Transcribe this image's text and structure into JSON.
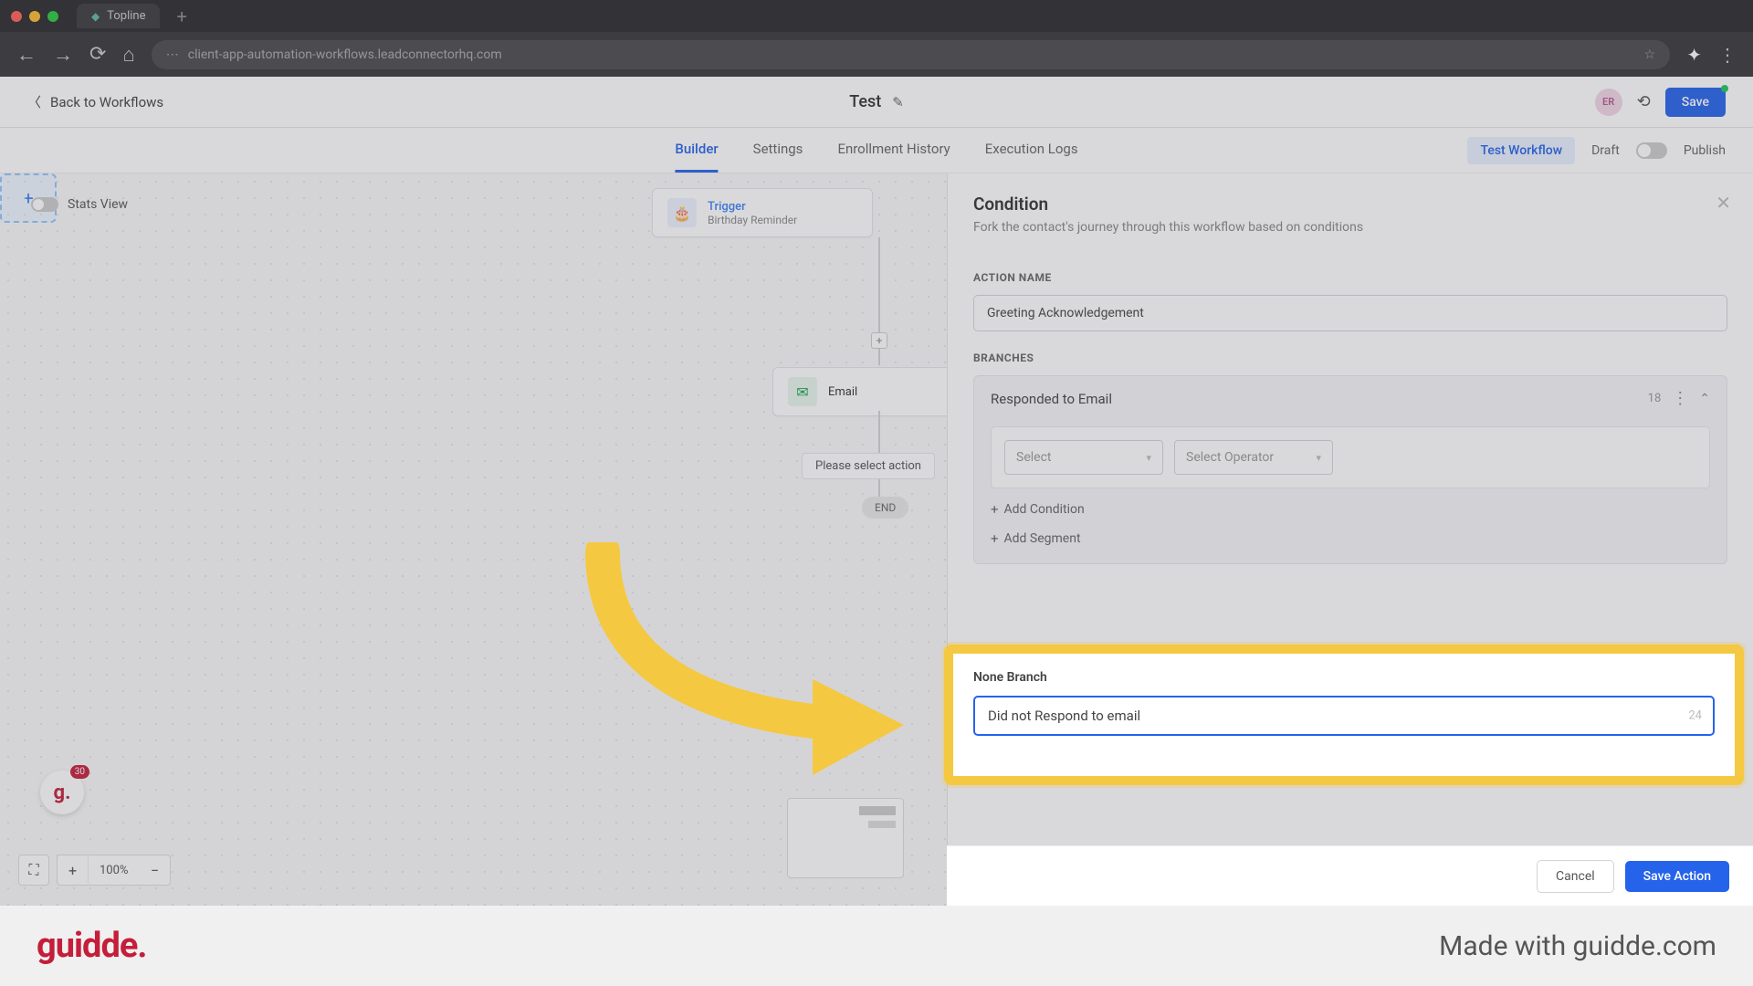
{
  "browser": {
    "tab_title": "Topline",
    "url": "client-app-automation-workflows.leadconnectorhq.com"
  },
  "header": {
    "back_label": "Back to Workflows",
    "workflow_title": "Test",
    "avatar_initials": "ER",
    "save_label": "Save"
  },
  "tabs": {
    "builder": "Builder",
    "settings": "Settings",
    "enrollment": "Enrollment History",
    "execution": "Execution Logs",
    "test_workflow": "Test Workflow",
    "draft": "Draft",
    "publish": "Publish"
  },
  "canvas": {
    "stats_view": "Stats View",
    "trigger_title": "Trigger",
    "trigger_sub": "Birthday Reminder",
    "email_label": "Email",
    "select_action": "Please select action",
    "end_label": "END",
    "zoom_pct": "100%"
  },
  "panel": {
    "title": "Condition",
    "desc": "Fork the contact's journey through this workflow based on conditions",
    "action_name_label": "ACTION NAME",
    "action_name_value": "Greeting Acknowledgement",
    "branches_label": "BRANCHES",
    "branch1_name": "Responded to Email",
    "branch1_count": "18",
    "select_placeholder": "Select",
    "operator_placeholder": "Select Operator",
    "add_condition": "Add Condition",
    "add_segment": "Add Segment",
    "none_branch_label": "None Branch",
    "none_branch_value": "Did not Respond to email",
    "none_branch_count": "24",
    "cancel": "Cancel",
    "save_action": "Save Action"
  },
  "footer": {
    "logo": "guidde.",
    "made_with": "Made with guidde.com"
  }
}
